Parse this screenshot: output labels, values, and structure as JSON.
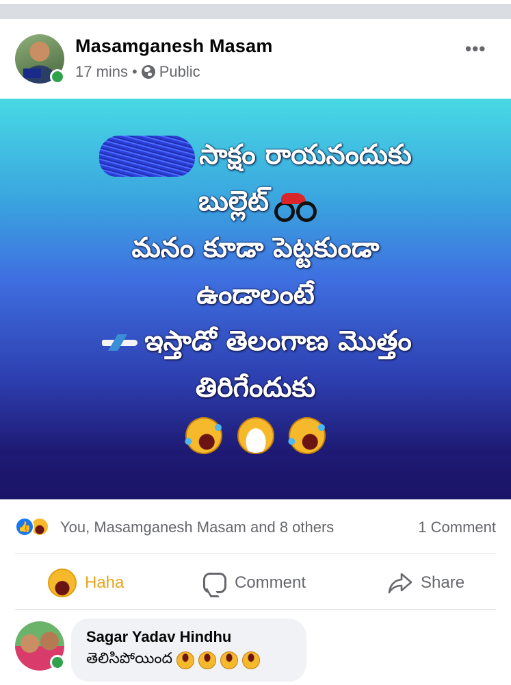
{
  "post": {
    "author": "Masamganesh Masam",
    "time": "17 mins",
    "separator": "•",
    "privacy": "Public",
    "more_label": "•••",
    "text_lines": [
      "సాక్షం రాయనందుకు",
      "బుల్లెట్",
      "మనం కూడా పెట్టకుండా",
      "ఉండాలంటే",
      "ఇస్తాడో తెలంగాణ మొత్తం",
      "తిరిగేందుకు"
    ],
    "emoji_line": [
      "rolling-on-floor-laughing",
      "grinning-squinting",
      "rolling-on-floor-laughing"
    ]
  },
  "reactions": {
    "icons": [
      "like",
      "haha"
    ],
    "summary": "You, Masamganesh Masam and 8 others",
    "comment_count": "1 Comment"
  },
  "actions": {
    "haha_label": "Haha",
    "comment_label": "Comment",
    "share_label": "Share"
  },
  "comment": {
    "author": "Sagar Yadav Hindhu",
    "text": "తెలిసిపోయింద",
    "emojis": [
      "upside-down-face",
      "upside-down-face",
      "upside-down-face",
      "upside-down-face"
    ]
  },
  "colors": {
    "accent_blue": "#1877f2",
    "haha_yellow": "#e7a41d",
    "online_green": "#31a24c",
    "muted_text": "#65676b"
  }
}
